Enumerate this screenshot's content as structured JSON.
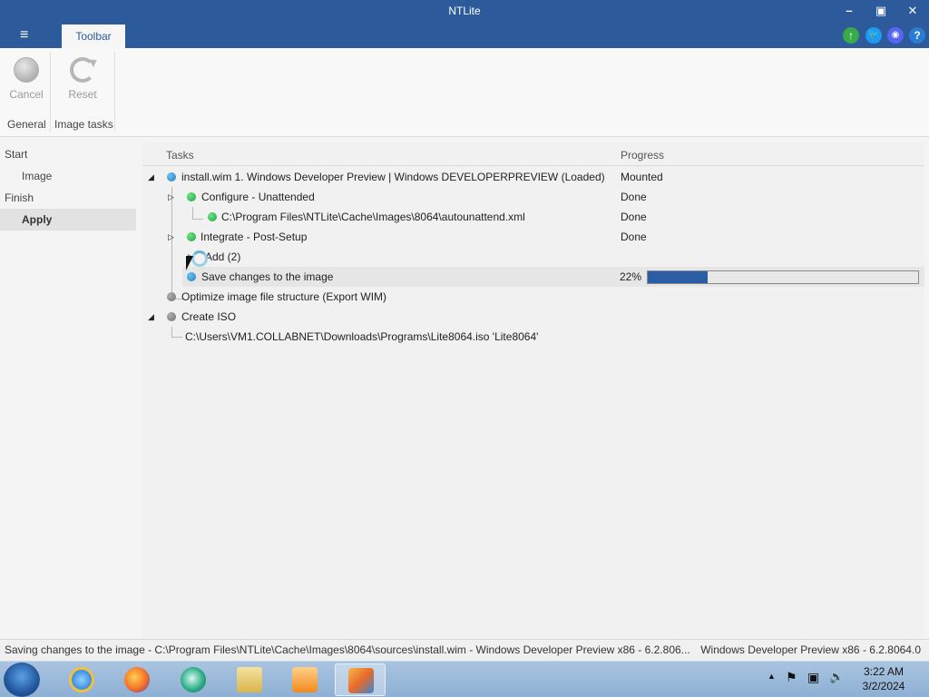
{
  "window": {
    "title": "NTLite",
    "minimize": "–",
    "maximize": "▣",
    "close": "✕"
  },
  "ribbon": {
    "menu_icon": "≡",
    "tab": "Toolbar",
    "icons": {
      "update": "↑",
      "twitter": "🐦",
      "discord": "◉",
      "help": "?"
    },
    "colors": {
      "update": "#3aa94a",
      "twitter": "#1d9bf0",
      "discord": "#5865f2",
      "help": "#2a7bd4"
    },
    "buttons": {
      "cancel": "Cancel",
      "reset": "Reset"
    },
    "groups": {
      "general": "General",
      "image_tasks": "Image tasks"
    }
  },
  "nav": {
    "start": "Start",
    "image": "Image",
    "finish": "Finish",
    "apply": "Apply"
  },
  "tasks": {
    "col_tasks": "Tasks",
    "col_progress": "Progress",
    "rows": [
      {
        "text": "install.wim 1. Windows Developer Preview  |  Windows DEVELOPERPREVIEW  (Loaded)",
        "progress": "Mounted"
      },
      {
        "text": "Configure - Unattended",
        "progress": "Done"
      },
      {
        "text": "C:\\Program Files\\NTLite\\Cache\\Images\\8064\\autounattend.xml",
        "progress": "Done"
      },
      {
        "text": "Integrate - Post-Setup",
        "progress": "Done"
      },
      {
        "text": "Add (2)",
        "progress": ""
      },
      {
        "text": "Save changes to the image",
        "progress": "22%"
      },
      {
        "text": "Optimize image file structure (Export WIM)",
        "progress": ""
      },
      {
        "text": "Create ISO",
        "progress": ""
      },
      {
        "text": "C:\\Users\\VM1.COLLABNET\\Downloads\\Programs\\Lite8064.iso 'Lite8064'",
        "progress": ""
      }
    ],
    "save_progress_value": 0.22
  },
  "status": {
    "left": "Saving changes to the image - C:\\Program Files\\NTLite\\Cache\\Images\\8064\\sources\\install.wim - Windows Developer Preview x86 - 6.2.806...",
    "right": "Windows Developer Preview x86 - 6.2.8064.0"
  },
  "taskbar": {
    "time": "3:22 AM",
    "date": "3/2/2024",
    "apps": [
      "internet-explorer",
      "firefox",
      "tor-browser",
      "file-explorer",
      "media-player",
      "ntlite"
    ],
    "tray": {
      "arrow": "▲",
      "flag": "⚑",
      "network": "▣",
      "volume": "🔈"
    }
  }
}
